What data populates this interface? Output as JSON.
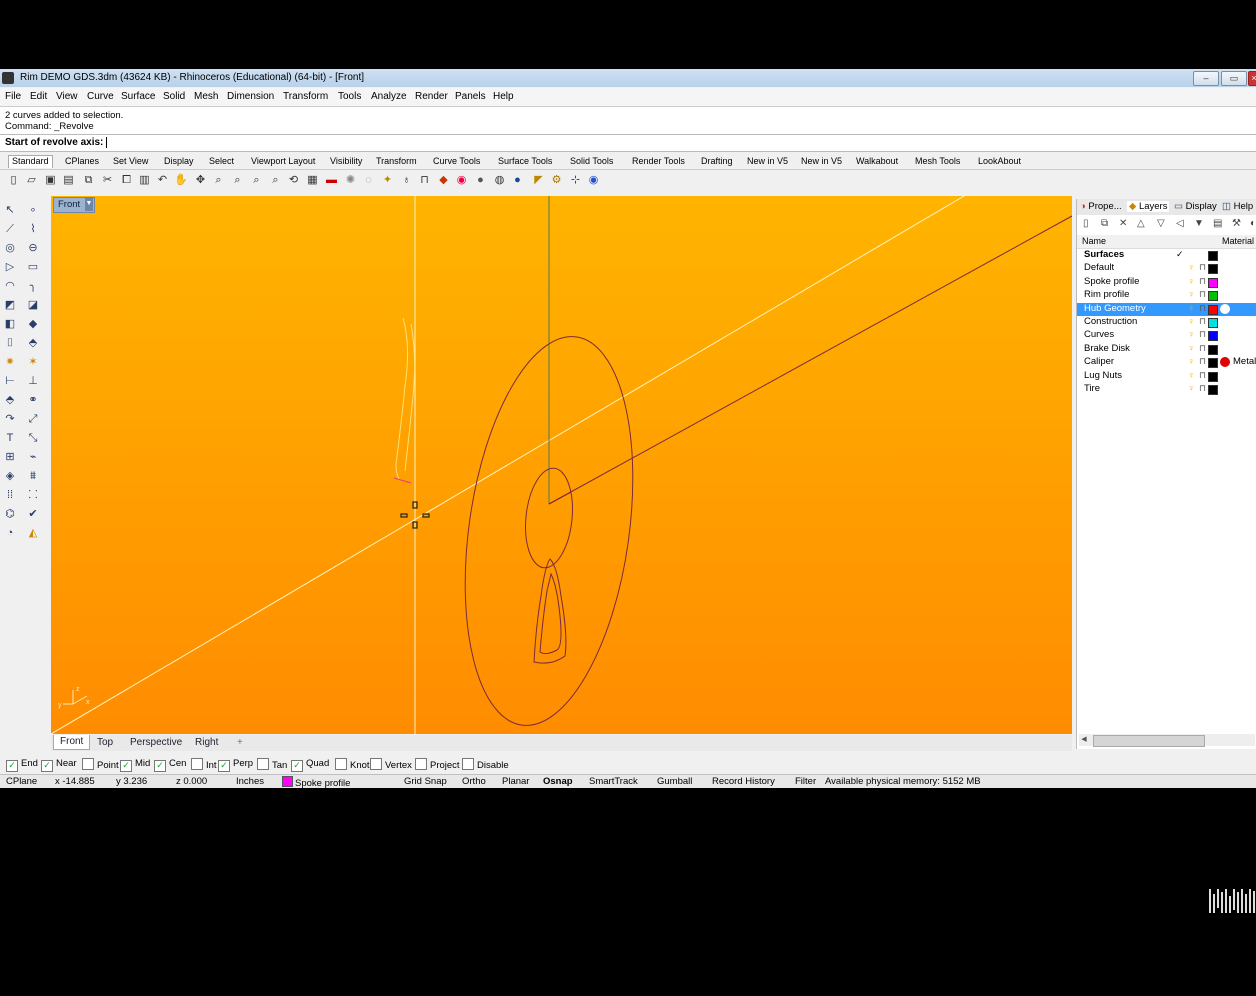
{
  "window": {
    "title": "Rim DEMO GDS.3dm (43624 KB) - Rhinoceros (Educational) (64-bit) - [Front]",
    "controls": [
      "–",
      "▭",
      "×"
    ]
  },
  "menubar": [
    "File",
    "Edit",
    "View",
    "Curve",
    "Surface",
    "Solid",
    "Mesh",
    "Dimension",
    "Transform",
    "Tools",
    "Analyze",
    "Render",
    "Panels",
    "Help"
  ],
  "command": {
    "history": [
      "2 curves added to selection.",
      "Command: _Revolve"
    ],
    "prompt": "Start of revolve axis:"
  },
  "toolbar_tabs": [
    "Standard",
    "CPlanes",
    "Set View",
    "Display",
    "Select",
    "Viewport Layout",
    "Visibility",
    "Transform",
    "Curve Tools",
    "Surface Tools",
    "Solid Tools",
    "Render Tools",
    "Drafting",
    "New in V5",
    "New in V5",
    "Walkabout",
    "Mesh Tools",
    "LookAbout"
  ],
  "toolbar_icons": [
    "new-icon",
    "open-icon",
    "save-icon",
    "print-icon",
    "import-icon",
    "cut-icon",
    "copy-icon",
    "paste-icon",
    "undo-icon",
    "pan-icon",
    "rotate-view-icon",
    "zoom-dynamic-icon",
    "zoom-window-icon",
    "zoom-extents-icon",
    "zoom-selected-icon",
    "viewport-icon",
    "grid-icon",
    "car-icon",
    "point-icon",
    "circle-icon",
    "light-icon",
    "bulb-icon",
    "lock-icon",
    "paint-icon",
    "color-wheel-icon",
    "sphere-icon",
    "shaded-sphere-icon",
    "render-sphere-icon",
    "spotlight-icon",
    "gear-icon",
    "options-icon",
    "help-icon"
  ],
  "viewport": {
    "label": "Front",
    "tabs": [
      "Front",
      "Top",
      "Perspective",
      "Right",
      "+"
    ],
    "axes": {
      "z": "z",
      "y": "y",
      "x": "x"
    }
  },
  "panel": {
    "tabs": [
      "Prope...",
      "Layers",
      "Display",
      "Help"
    ],
    "columns": {
      "name": "Name",
      "material": "Material"
    },
    "layers": [
      {
        "name": "Surfaces",
        "current": "✓",
        "color": "#000000",
        "bold": true
      },
      {
        "name": "Default",
        "color": "#000000"
      },
      {
        "name": "Spoke profile",
        "color": "#ff00ff"
      },
      {
        "name": "Rim profile",
        "color": "#00c000"
      },
      {
        "name": "Hub Geometry",
        "color": "#ff0000",
        "selected": true
      },
      {
        "name": "Construction",
        "color": "#00e0e0"
      },
      {
        "name": "Curves",
        "color": "#0000ff"
      },
      {
        "name": "Brake Disk",
        "color": "#000000"
      },
      {
        "name": "Caliper",
        "color": "#000000",
        "material_color": "#e00000",
        "material": "Metall"
      },
      {
        "name": "Lug Nuts",
        "color": "#000000"
      },
      {
        "name": "Tire",
        "color": "#000000"
      }
    ]
  },
  "osnap": [
    {
      "label": "End",
      "checked": true
    },
    {
      "label": "Near",
      "checked": true
    },
    {
      "label": "Point",
      "checked": false
    },
    {
      "label": "Mid",
      "checked": true
    },
    {
      "label": "Cen",
      "checked": true
    },
    {
      "label": "Int",
      "checked": false
    },
    {
      "label": "Perp",
      "checked": true
    },
    {
      "label": "Tan",
      "checked": false
    },
    {
      "label": "Quad",
      "checked": true
    },
    {
      "label": "Knot",
      "checked": false
    },
    {
      "label": "Vertex",
      "checked": false
    },
    {
      "label": "Project",
      "checked": false
    },
    {
      "label": "Disable",
      "checked": false
    }
  ],
  "status": {
    "cplane": "CPlane",
    "x": "x -14.885",
    "y": "y 3.236",
    "z": "z 0.000",
    "units": "Inches",
    "layer": "Spoke profile",
    "layer_color": "#ff00ff",
    "toggles": [
      "Grid Snap",
      "Ortho",
      "Planar",
      "Osnap",
      "SmartTrack",
      "Gumball",
      "Record History",
      "Filter"
    ],
    "memory": "Available physical memory: 5152 MB"
  }
}
